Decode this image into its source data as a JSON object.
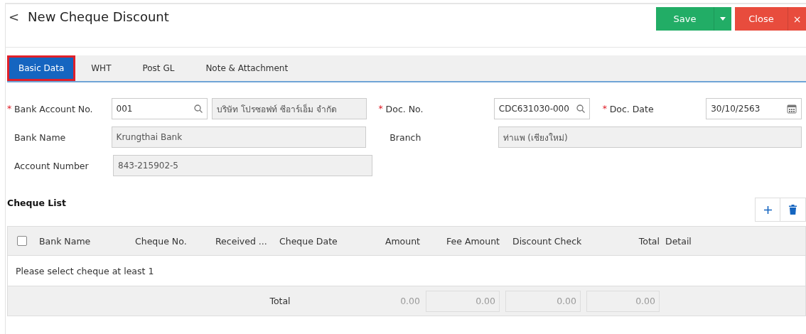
{
  "header": {
    "back": "<",
    "title": "New Cheque Discount",
    "buttons": [
      {
        "label": "Save",
        "kind": "save"
      },
      {
        "label": "Close",
        "kind": "close"
      }
    ],
    "close_x": "×"
  },
  "tabs": [
    {
      "label": "Basic Data",
      "selected": true
    },
    {
      "label": "WHT",
      "selected": false
    },
    {
      "label": "Post GL",
      "selected": false
    },
    {
      "label": "Note & Attachment",
      "selected": false
    }
  ],
  "required_marker": "*",
  "form": {
    "bank_account_no": {
      "label": "Bank Account No.",
      "required": true,
      "value": "001",
      "name": "บริษัท โปรซอฟท์ ซีอาร์เอ็ม จำกัด"
    },
    "doc_no": {
      "label": "Doc. No.",
      "required": true,
      "value": "CDC631030-000"
    },
    "doc_date": {
      "label": "Doc. Date",
      "required": true,
      "value": "30/10/2563"
    },
    "bank_name": {
      "label": "Bank Name",
      "value": "Krungthai Bank"
    },
    "branch": {
      "label": "Branch",
      "value": "ท่าแพ (เชียงใหม่)"
    },
    "account_number": {
      "label": "Account Number",
      "value": "843-215902-5"
    }
  },
  "cheque_list": {
    "title": "Cheque List",
    "select_all": {
      "checked": false
    },
    "columns": [
      "Bank Name",
      "Cheque No.",
      "Received ...",
      "Cheque Date",
      "Amount",
      "Fee Amount",
      "Discount Check",
      "Total",
      "Detail"
    ],
    "empty_message": "Please select cheque at least 1",
    "total_label": "Total",
    "totals": {
      "amount": "0.00",
      "fee_amount": "0.00",
      "discount_check": "0.00",
      "total": "0.00"
    }
  }
}
